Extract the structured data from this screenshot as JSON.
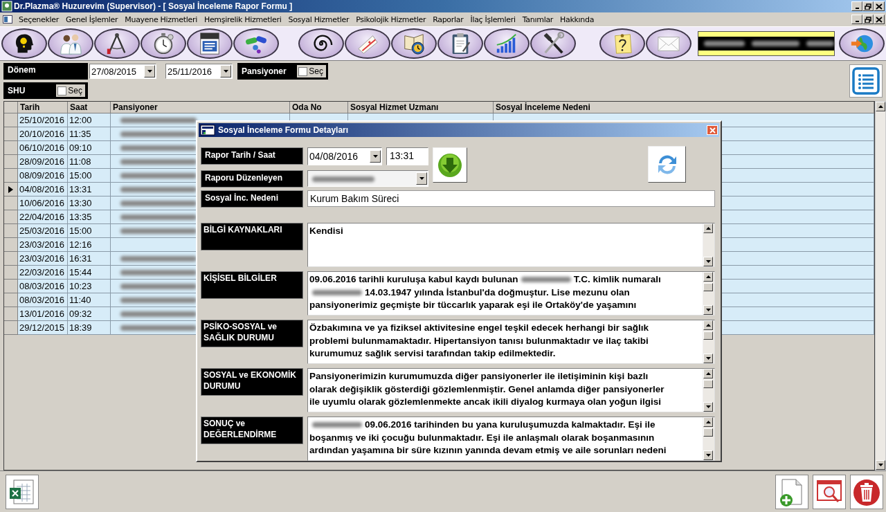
{
  "window": {
    "title": "Dr.Plazma® Huzurevim (Supervisor) - [ Sosyal İnceleme Rapor Formu ]"
  },
  "menu": {
    "items": [
      "Seçenekler",
      "Genel İşlemler",
      "Muayene Hizmetleri",
      "Hemşirelik Hizmetleri",
      "Sosyal Hizmetler",
      "Psikolojik Hizmetler",
      "Raporlar",
      "İlaç İşlemleri",
      "Tanımlar",
      "Hakkında"
    ]
  },
  "toolbar": {
    "left": [
      {
        "kind": "head"
      },
      {
        "kind": "doctors"
      },
      {
        "kind": "compass"
      },
      {
        "kind": "stopwatch"
      },
      {
        "kind": "document"
      },
      {
        "kind": "capsules"
      }
    ],
    "middle": [
      {
        "kind": "spiral"
      },
      {
        "kind": "nurse-cap"
      },
      {
        "kind": "book-clock"
      },
      {
        "kind": "clipboard"
      },
      {
        "kind": "chart"
      },
      {
        "kind": "tools"
      }
    ],
    "right": [
      {
        "kind": "note"
      },
      {
        "kind": "mail"
      }
    ],
    "end": [
      {
        "kind": "globe"
      }
    ]
  },
  "filters": {
    "period": {
      "label": "Dönem",
      "start": "27/08/2015",
      "end": "25/11/2016"
    },
    "pansiyoner": {
      "label": "Pansiyoner",
      "option": "Seç",
      "checked": false
    },
    "shu": {
      "label": "SHU",
      "option": "Seç",
      "checked": false
    }
  },
  "table": {
    "columns": [
      "Tarih",
      "Saat",
      "Pansiyoner",
      "Oda No",
      "Sosyal Hizmet Uzmanı",
      "Sosyal İnceleme Nedeni"
    ],
    "rows": [
      {
        "tarih": "25/10/2016",
        "saat": "12:00",
        "name_hidden": true,
        "selected": false
      },
      {
        "tarih": "20/10/2016",
        "saat": "11:35",
        "name_hidden": true,
        "selected": false
      },
      {
        "tarih": "06/10/2016",
        "saat": "09:10",
        "name_hidden": true,
        "selected": false
      },
      {
        "tarih": "28/09/2016",
        "saat": "11:08",
        "name_hidden": true,
        "selected": false
      },
      {
        "tarih": "08/09/2016",
        "saat": "15:00",
        "name_hidden": true,
        "selected": false
      },
      {
        "tarih": "04/08/2016",
        "saat": "13:31",
        "name_hidden": true,
        "selected": true
      },
      {
        "tarih": "10/06/2016",
        "saat": "13:30",
        "name_hidden": true,
        "selected": false
      },
      {
        "tarih": "22/04/2016",
        "saat": "13:35",
        "name_hidden": true,
        "selected": false
      },
      {
        "tarih": "25/03/2016",
        "saat": "15:00",
        "name_hidden": true,
        "selected": false
      },
      {
        "tarih": "23/03/2016",
        "saat": "12:16",
        "name_hidden": false,
        "selected": false
      },
      {
        "tarih": "23/03/2016",
        "saat": "16:31",
        "name_hidden": true,
        "selected": false
      },
      {
        "tarih": "22/03/2016",
        "saat": "15:44",
        "name_hidden": true,
        "selected": false
      },
      {
        "tarih": "08/03/2016",
        "saat": "10:23",
        "name_hidden": true,
        "selected": false
      },
      {
        "tarih": "08/03/2016",
        "saat": "11:40",
        "name_hidden": true,
        "selected": false
      },
      {
        "tarih": "13/01/2016",
        "saat": "09:32",
        "name_hidden": true,
        "selected": false
      },
      {
        "tarih": "29/12/2015",
        "saat": "18:39",
        "name_hidden": true,
        "selected": false
      }
    ]
  },
  "dialog": {
    "title": "Sosyal İnceleme Formu Detayları",
    "report_datetime": {
      "label": "Rapor Tarih / Saat",
      "date": "04/08/2016",
      "time": "13:31"
    },
    "prepared_by": {
      "label": "Raporu Düzenleyen"
    },
    "reason": {
      "label": "Sosyal İnc. Nedeni",
      "value": "Kurum Bakım Süreci"
    },
    "sections": [
      {
        "label": "BİLGİ KAYNAKLARI",
        "lines": [
          [
            {
              "kind": "text",
              "text": "Kendisi"
            }
          ]
        ]
      },
      {
        "label": "KİŞİSEL BİLGİLER",
        "lines": [
          [
            {
              "kind": "text",
              "text": "09.06.2016 tarihli kuruluşa kabul kaydı bulunan"
            },
            {
              "kind": "redacted"
            },
            {
              "kind": "text",
              "text": "T.C. kimlik numaralı"
            }
          ],
          [
            {
              "kind": "redacted"
            },
            {
              "kind": "text",
              "text": "14.03.1947 yılında İstanbul'da doğmuştur. Lise mezunu olan"
            }
          ],
          [
            {
              "kind": "text",
              "text": "pansiyonerimiz geçmişte bir tüccarlık yaparak eşi ile Ortaköy'de yaşamını"
            }
          ]
        ]
      },
      {
        "label": "PSİKO-SOSYAL ve SAĞLIK DURUMU",
        "lines": [
          [
            {
              "kind": "text",
              "text": "Özbakımına ve ya fiziksel aktivitesine engel teşkil edecek herhangi bir sağlık"
            }
          ],
          [
            {
              "kind": "text",
              "text": "problemi bulunmamaktadır. Hipertansiyon tanısı bulunmaktadır ve ilaç takibi"
            }
          ],
          [
            {
              "kind": "text",
              "text": "kurumumuz sağlık servisi tarafından takip edilmektedir."
            }
          ]
        ]
      },
      {
        "label": "SOSYAL ve EKONOMİK DURUMU",
        "lines": [
          [
            {
              "kind": "text",
              "text": "Pansiyonerimizin kurumumuzda diğer pansiyonerler ile iletişiminin kişi bazlı"
            }
          ],
          [
            {
              "kind": "text",
              "text": "olarak değişiklik gösterdiği gözlemlenmiştir. Genel anlamda diğer pansiyonerler"
            }
          ],
          [
            {
              "kind": "text",
              "text": "ile uyumlu olarak gözlemlenmekte ancak ikili diyalog kurmaya olan yoğun ilgisi"
            }
          ]
        ]
      },
      {
        "label": "SONUÇ ve DEĞERLENDİRME",
        "lines": [
          [
            {
              "kind": "redacted"
            },
            {
              "kind": "text",
              "text": "09.06.2016 tarihinden bu yana kuruluşumuzda kalmaktadır. Eşi ile"
            }
          ],
          [
            {
              "kind": "text",
              "text": "boşanmış ve iki çocuğu bulunmaktadır. Eşi ile anlaşmalı olarak boşanmasının"
            }
          ],
          [
            {
              "kind": "text",
              "text": "ardından yaşamına bir süre kızının yanında devam etmiş ve aile sorunları nedeni"
            }
          ]
        ]
      }
    ]
  },
  "bottom_bar": {
    "left": [
      {
        "kind": "excel"
      }
    ],
    "right": [
      {
        "kind": "new"
      },
      {
        "kind": "preview"
      },
      {
        "kind": "delete"
      }
    ]
  }
}
